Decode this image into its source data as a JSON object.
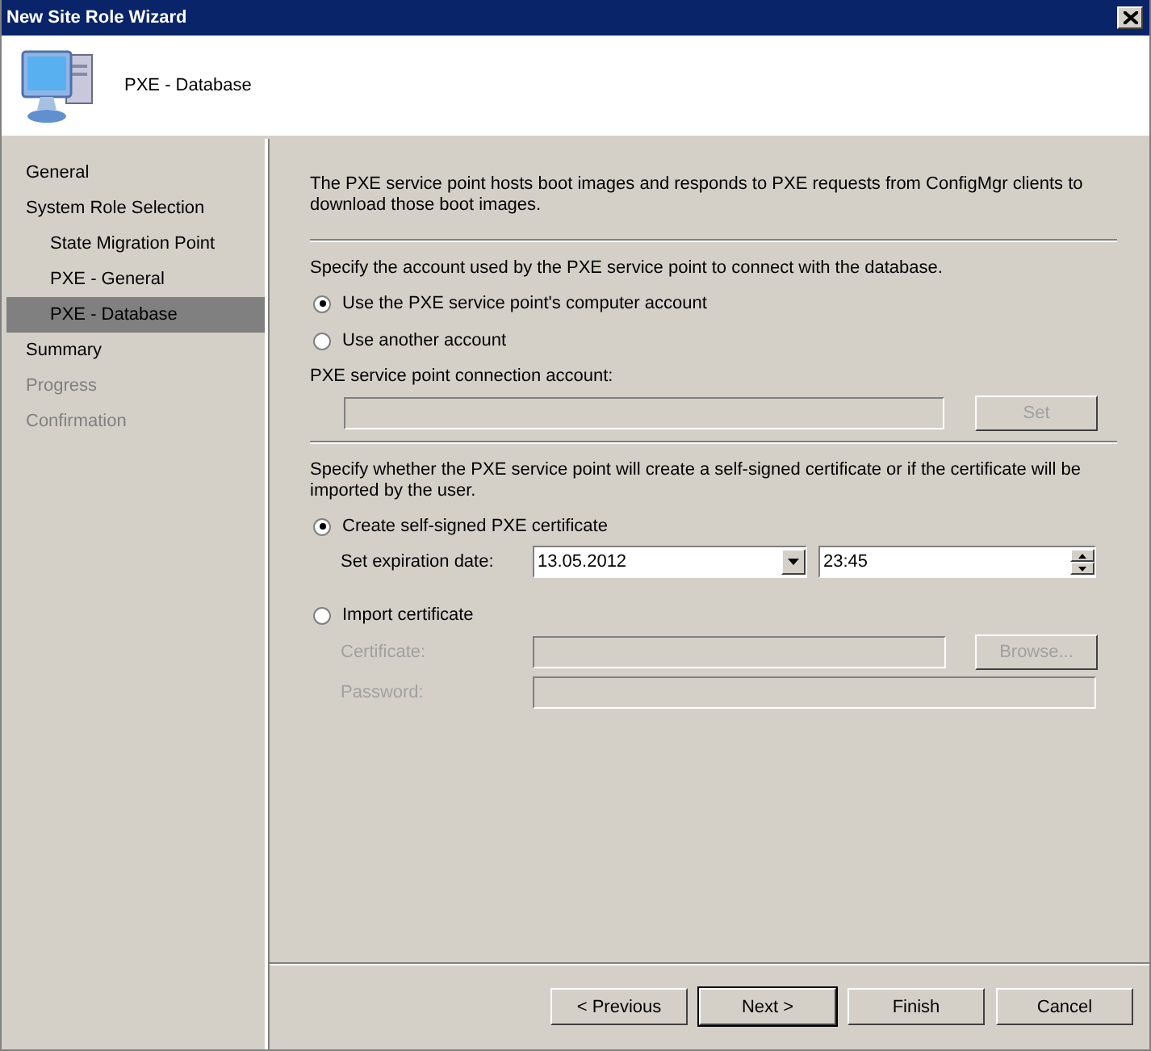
{
  "window": {
    "title": "New Site Role Wizard"
  },
  "header": {
    "title": "PXE - Database"
  },
  "sidebar": {
    "items": [
      {
        "label": "General",
        "selected": false,
        "disabled": false
      },
      {
        "label": "System Role Selection",
        "selected": false,
        "disabled": false,
        "children": [
          {
            "label": "State Migration Point",
            "selected": false,
            "disabled": false
          },
          {
            "label": "PXE - General",
            "selected": false,
            "disabled": false
          },
          {
            "label": "PXE - Database",
            "selected": true,
            "disabled": false
          }
        ]
      },
      {
        "label": "Summary",
        "selected": false,
        "disabled": false
      },
      {
        "label": "Progress",
        "selected": false,
        "disabled": true
      },
      {
        "label": "Confirmation",
        "selected": false,
        "disabled": true
      }
    ]
  },
  "content": {
    "intro": "The PXE service point hosts boot images and responds to PXE requests from ConfigMgr clients to download those boot images.",
    "account_section": {
      "prompt": "Specify the account used by the PXE service point to connect with the database.",
      "options": [
        {
          "label": "Use the PXE service point's computer account",
          "selected": true
        },
        {
          "label": "Use another account",
          "selected": false
        }
      ],
      "account_label": "PXE service point connection account:",
      "account_field": {
        "disabled": true
      },
      "set_button": {
        "label": "Set",
        "disabled": true
      }
    },
    "certificate_section": {
      "prompt": "Specify whether the PXE service point will create a self-signed certificate or if the certificate will be imported by the user.",
      "create_option": {
        "label": "Create self-signed PXE certificate",
        "selected": true
      },
      "expiration_label": "Set expiration date:",
      "date": "13.05.2012",
      "time": "23:45",
      "import_option": {
        "label": "Import certificate",
        "selected": false
      },
      "certificate": {
        "label": "Certificate:",
        "disabled": true
      },
      "browse_button": {
        "label": "Browse...",
        "disabled": true
      },
      "password": {
        "label": "Password:",
        "disabled": true
      }
    }
  },
  "buttons": [
    {
      "label": "< Previous",
      "default": false
    },
    {
      "label": "Next >",
      "default": true
    },
    {
      "label": "Finish",
      "default": false
    },
    {
      "label": "Cancel",
      "default": false
    }
  ]
}
